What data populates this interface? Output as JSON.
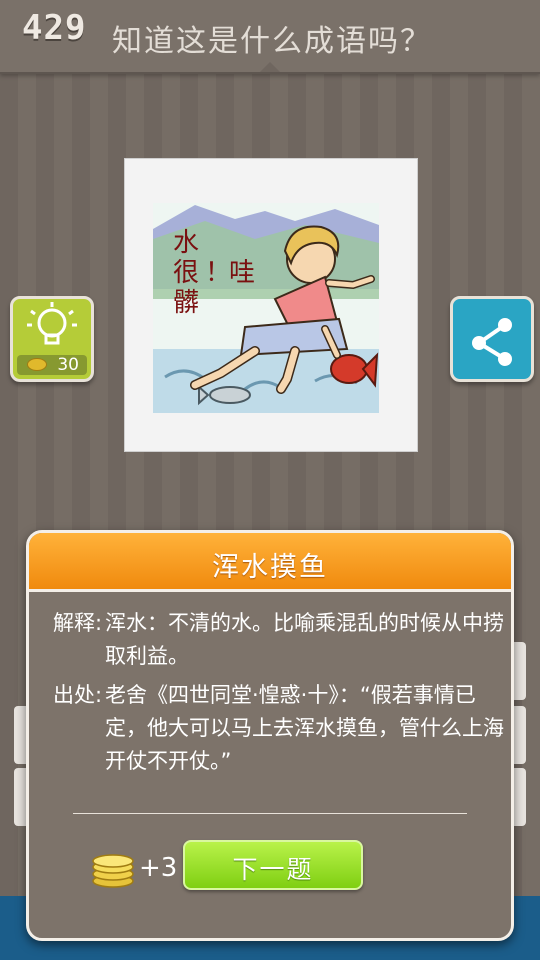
{
  "header": {
    "level": "429",
    "question": "知道这是什么成语吗？"
  },
  "puzzle": {
    "image_text": [
      "水",
      "很",
      "！",
      "哇",
      "髒"
    ]
  },
  "hint_button": {
    "icon": "lightbulb-icon",
    "cost": "30"
  },
  "share_button": {
    "icon": "share-icon"
  },
  "popup": {
    "title": "浑水摸鱼",
    "explanation_label": "解释:",
    "explanation": "浑水：不清的水。比喻乘混乱的时候从中捞取利益。",
    "source_label": "出处:",
    "source": "老舍《四世同堂·惶惑·十》：“假若事情已定，他大可以马上去浑水摸鱼，管什么上海开仗不开仗。”",
    "reward": "+3",
    "next_button": "下一题"
  },
  "colors": {
    "accent_orange": "#f08a0e",
    "next_green": "#7fcf12",
    "hint_green": "#b5cc38",
    "share_blue": "#2aa5c4"
  }
}
